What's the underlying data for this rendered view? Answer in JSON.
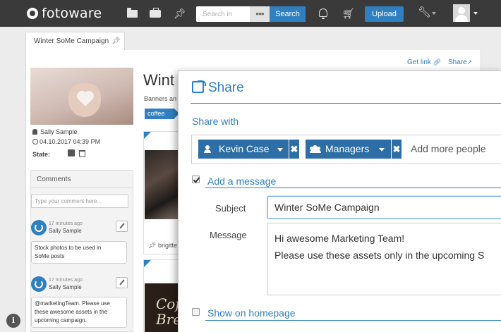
{
  "topbar": {
    "logo_text": "fotoware",
    "search_placeholder": "Search in",
    "search_options": "●●●",
    "search_button": "Search",
    "upload_button": "Upload"
  },
  "tab": {
    "label": "Winter SoMe Campaign"
  },
  "sidebar": {
    "owner": "Sally Sample",
    "date": "04.10.2017 04:39 PM",
    "state_label": "State:"
  },
  "comments": {
    "title": "Comments",
    "input_placeholder": "Type your comment here...",
    "items": [
      {
        "time": "17 minutes ago",
        "author": "Sally Sample",
        "lines": [
          "Stock photos to be used in",
          "SoMe posts"
        ]
      },
      {
        "time": "17 minutes ago",
        "author": "Sally Sample",
        "lines": [
          "@marketingTeam. Please use",
          "these awesome assets in the",
          "upcoming campaign."
        ]
      }
    ]
  },
  "background": {
    "title": "Wint",
    "subtitle": "Banners an",
    "tag": "coffee",
    "card_label": "brigitte",
    "coffee_text": "Coff Brea",
    "get_link": "Get link",
    "share": "Share"
  },
  "modal": {
    "title": "Share",
    "share_with_label": "Share with",
    "recipients": [
      {
        "name": "Kevin Case"
      },
      {
        "name": "Managers"
      }
    ],
    "remove_glyph": "✖",
    "add_people_placeholder": "Add more people",
    "add_message_label": "Add a message",
    "add_message_checked": true,
    "subject_label": "Subject",
    "subject_value": "Winter SoMe Campaign",
    "message_label": "Message",
    "message_lines": [
      "Hi awesome Marketing Team!",
      "Please use these assets only in the upcoming S"
    ],
    "show_on_homepage_label": "Show on homepage",
    "show_on_homepage_checked": false
  },
  "colors": {
    "accent": "#2f7fc1",
    "chip": "#2c6ea5",
    "topbar": "#3a3a3a"
  }
}
